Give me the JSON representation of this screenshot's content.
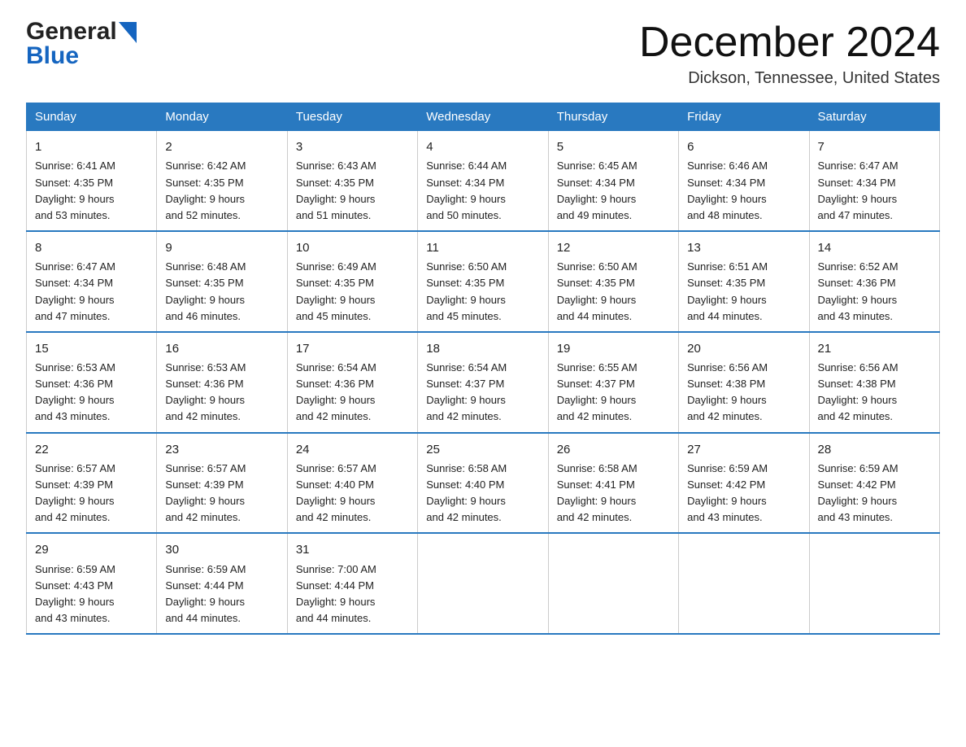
{
  "header": {
    "logo_general": "General",
    "logo_blue": "Blue",
    "month_title": "December 2024",
    "location": "Dickson, Tennessee, United States"
  },
  "days_of_week": [
    "Sunday",
    "Monday",
    "Tuesday",
    "Wednesday",
    "Thursday",
    "Friday",
    "Saturday"
  ],
  "weeks": [
    [
      {
        "day": "1",
        "sunrise": "6:41 AM",
        "sunset": "4:35 PM",
        "daylight": "9 hours and 53 minutes."
      },
      {
        "day": "2",
        "sunrise": "6:42 AM",
        "sunset": "4:35 PM",
        "daylight": "9 hours and 52 minutes."
      },
      {
        "day": "3",
        "sunrise": "6:43 AM",
        "sunset": "4:35 PM",
        "daylight": "9 hours and 51 minutes."
      },
      {
        "day": "4",
        "sunrise": "6:44 AM",
        "sunset": "4:34 PM",
        "daylight": "9 hours and 50 minutes."
      },
      {
        "day": "5",
        "sunrise": "6:45 AM",
        "sunset": "4:34 PM",
        "daylight": "9 hours and 49 minutes."
      },
      {
        "day": "6",
        "sunrise": "6:46 AM",
        "sunset": "4:34 PM",
        "daylight": "9 hours and 48 minutes."
      },
      {
        "day": "7",
        "sunrise": "6:47 AM",
        "sunset": "4:34 PM",
        "daylight": "9 hours and 47 minutes."
      }
    ],
    [
      {
        "day": "8",
        "sunrise": "6:47 AM",
        "sunset": "4:34 PM",
        "daylight": "9 hours and 47 minutes."
      },
      {
        "day": "9",
        "sunrise": "6:48 AM",
        "sunset": "4:35 PM",
        "daylight": "9 hours and 46 minutes."
      },
      {
        "day": "10",
        "sunrise": "6:49 AM",
        "sunset": "4:35 PM",
        "daylight": "9 hours and 45 minutes."
      },
      {
        "day": "11",
        "sunrise": "6:50 AM",
        "sunset": "4:35 PM",
        "daylight": "9 hours and 45 minutes."
      },
      {
        "day": "12",
        "sunrise": "6:50 AM",
        "sunset": "4:35 PM",
        "daylight": "9 hours and 44 minutes."
      },
      {
        "day": "13",
        "sunrise": "6:51 AM",
        "sunset": "4:35 PM",
        "daylight": "9 hours and 44 minutes."
      },
      {
        "day": "14",
        "sunrise": "6:52 AM",
        "sunset": "4:36 PM",
        "daylight": "9 hours and 43 minutes."
      }
    ],
    [
      {
        "day": "15",
        "sunrise": "6:53 AM",
        "sunset": "4:36 PM",
        "daylight": "9 hours and 43 minutes."
      },
      {
        "day": "16",
        "sunrise": "6:53 AM",
        "sunset": "4:36 PM",
        "daylight": "9 hours and 42 minutes."
      },
      {
        "day": "17",
        "sunrise": "6:54 AM",
        "sunset": "4:36 PM",
        "daylight": "9 hours and 42 minutes."
      },
      {
        "day": "18",
        "sunrise": "6:54 AM",
        "sunset": "4:37 PM",
        "daylight": "9 hours and 42 minutes."
      },
      {
        "day": "19",
        "sunrise": "6:55 AM",
        "sunset": "4:37 PM",
        "daylight": "9 hours and 42 minutes."
      },
      {
        "day": "20",
        "sunrise": "6:56 AM",
        "sunset": "4:38 PM",
        "daylight": "9 hours and 42 minutes."
      },
      {
        "day": "21",
        "sunrise": "6:56 AM",
        "sunset": "4:38 PM",
        "daylight": "9 hours and 42 minutes."
      }
    ],
    [
      {
        "day": "22",
        "sunrise": "6:57 AM",
        "sunset": "4:39 PM",
        "daylight": "9 hours and 42 minutes."
      },
      {
        "day": "23",
        "sunrise": "6:57 AM",
        "sunset": "4:39 PM",
        "daylight": "9 hours and 42 minutes."
      },
      {
        "day": "24",
        "sunrise": "6:57 AM",
        "sunset": "4:40 PM",
        "daylight": "9 hours and 42 minutes."
      },
      {
        "day": "25",
        "sunrise": "6:58 AM",
        "sunset": "4:40 PM",
        "daylight": "9 hours and 42 minutes."
      },
      {
        "day": "26",
        "sunrise": "6:58 AM",
        "sunset": "4:41 PM",
        "daylight": "9 hours and 42 minutes."
      },
      {
        "day": "27",
        "sunrise": "6:59 AM",
        "sunset": "4:42 PM",
        "daylight": "9 hours and 43 minutes."
      },
      {
        "day": "28",
        "sunrise": "6:59 AM",
        "sunset": "4:42 PM",
        "daylight": "9 hours and 43 minutes."
      }
    ],
    [
      {
        "day": "29",
        "sunrise": "6:59 AM",
        "sunset": "4:43 PM",
        "daylight": "9 hours and 43 minutes."
      },
      {
        "day": "30",
        "sunrise": "6:59 AM",
        "sunset": "4:44 PM",
        "daylight": "9 hours and 44 minutes."
      },
      {
        "day": "31",
        "sunrise": "7:00 AM",
        "sunset": "4:44 PM",
        "daylight": "9 hours and 44 minutes."
      },
      null,
      null,
      null,
      null
    ]
  ],
  "labels": {
    "sunrise": "Sunrise:",
    "sunset": "Sunset:",
    "daylight": "Daylight:"
  }
}
